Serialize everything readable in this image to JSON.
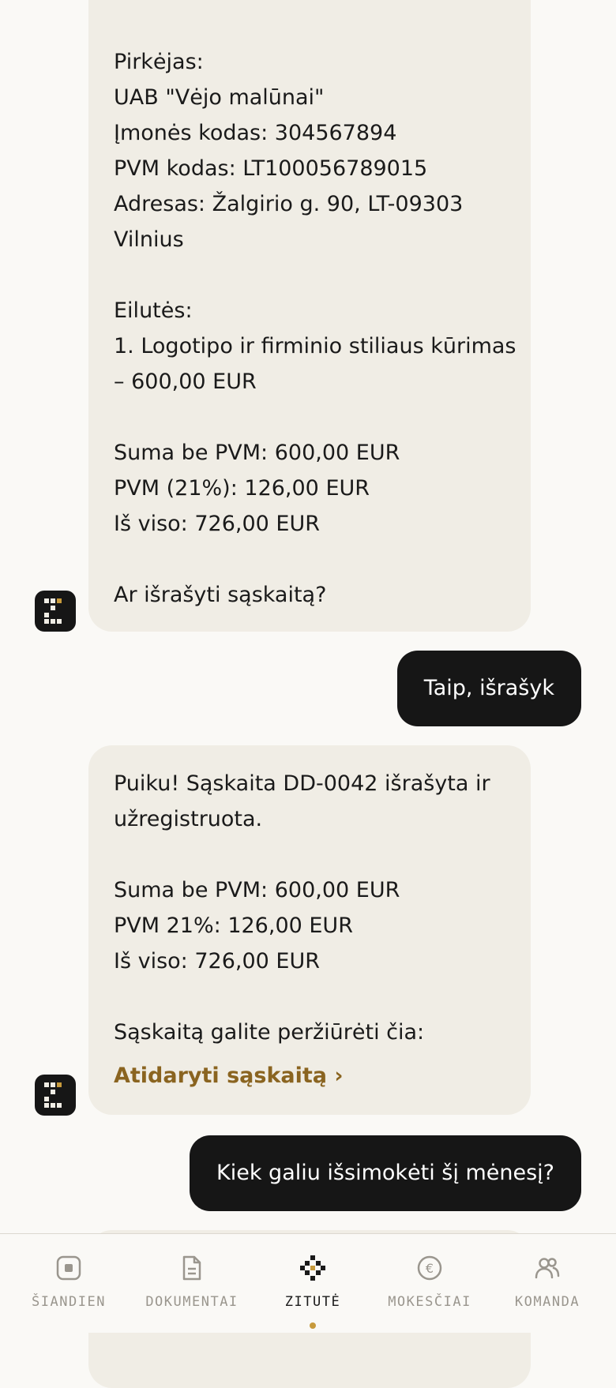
{
  "messages": {
    "bot1": {
      "lines": [
        "Pirkėjas:",
        "UAB \"Vėjo malūnai\"",
        "Įmonės kodas: 304567894",
        "PVM kodas: LT100056789015",
        "Adresas: Žalgirio g. 90, LT-09303",
        "Vilnius",
        "",
        "Eilutės:",
        "1. Logotipo ir firminio stiliaus kūrimas",
        "– 600,00 EUR",
        "",
        "Suma be PVM: 600,00 EUR",
        "PVM (21%): 126,00 EUR",
        "Iš viso: 726,00 EUR",
        "",
        "Ar išrašyti sąskaitą?"
      ]
    },
    "user1": "Taip, išrašyk",
    "bot2": {
      "lines": [
        "Puiku! Sąskaita DD-0042 išrašyta ir",
        "užregistruota.",
        "",
        "Suma be PVM: 600,00 EUR",
        "PVM 21%: 126,00 EUR",
        "Iš viso: 726,00 EUR",
        "",
        "Sąskaitą galite peržiūrėti čia:"
      ],
      "link": "Atidaryti sąskaitą ›"
    },
    "user2": "Kiek galiu išsimokėti šį mėnesį?"
  },
  "tabbar": {
    "active": "zitute",
    "accent": "#c79a3c",
    "tabs": [
      {
        "id": "siandien",
        "label": "ŠIANDIEN",
        "icon": "today-icon"
      },
      {
        "id": "dokumentai",
        "label": "DOKUMENTAI",
        "icon": "document-icon"
      },
      {
        "id": "zitute",
        "label": "ZITUTĖ",
        "icon": "assistant-icon"
      },
      {
        "id": "mokesciai",
        "label": "MOKESČIAI",
        "icon": "euro-icon"
      },
      {
        "id": "komanda",
        "label": "KOMANDA",
        "icon": "team-icon"
      }
    ]
  }
}
